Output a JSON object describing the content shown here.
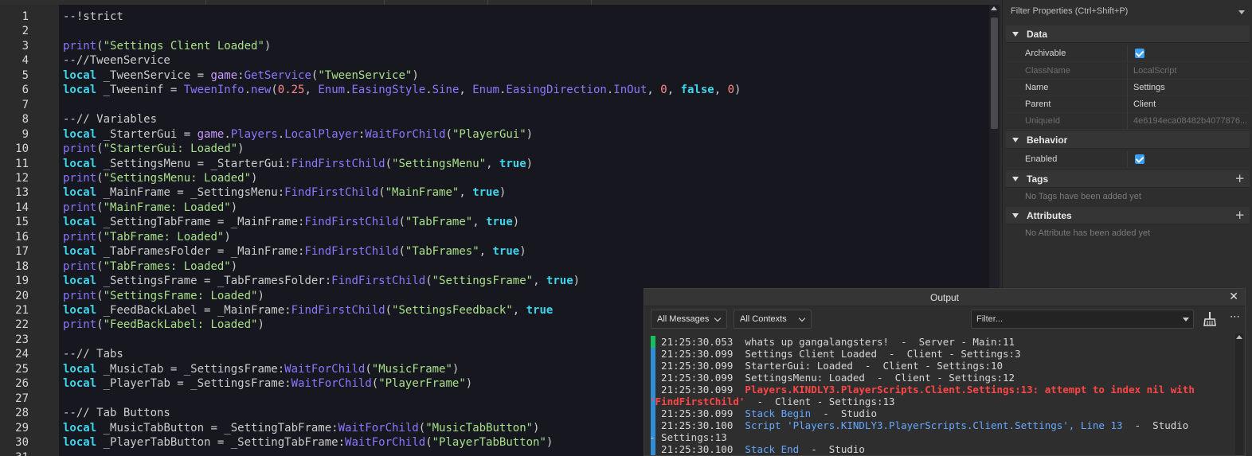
{
  "editor": {
    "lines": [
      {
        "n": "1",
        "tokens": [
          [
            "--!strict",
            "cm"
          ]
        ]
      },
      {
        "n": "2",
        "tokens": []
      },
      {
        "n": "3",
        "tokens": [
          [
            "print",
            "fn"
          ],
          [
            "(",
            "tx"
          ],
          [
            "\"Settings Client Loaded\"",
            "str"
          ],
          [
            ")",
            "tx"
          ]
        ]
      },
      {
        "n": "4",
        "tokens": [
          [
            "--//TweenService",
            "cm"
          ]
        ]
      },
      {
        "n": "5",
        "tokens": [
          [
            "local",
            "kw"
          ],
          [
            " _TweenService = ",
            "tx"
          ],
          [
            "game",
            "gm"
          ],
          [
            ":",
            "tx"
          ],
          [
            "GetService",
            "fn"
          ],
          [
            "(",
            "tx"
          ],
          [
            "\"TweenService\"",
            "str"
          ],
          [
            ")",
            "tx"
          ]
        ]
      },
      {
        "n": "6",
        "tokens": [
          [
            "local",
            "kw"
          ],
          [
            " _Tweeninf = ",
            "tx"
          ],
          [
            "TweenInfo",
            "fn"
          ],
          [
            ".",
            "tx"
          ],
          [
            "new",
            "fn"
          ],
          [
            "(",
            "tx"
          ],
          [
            "0.25",
            "num"
          ],
          [
            ", ",
            "tx"
          ],
          [
            "Enum",
            "fn"
          ],
          [
            ".",
            "tx"
          ],
          [
            "EasingStyle",
            "fn"
          ],
          [
            ".",
            "tx"
          ],
          [
            "Sine",
            "fn"
          ],
          [
            ", ",
            "tx"
          ],
          [
            "Enum",
            "fn"
          ],
          [
            ".",
            "tx"
          ],
          [
            "EasingDirection",
            "fn"
          ],
          [
            ".",
            "tx"
          ],
          [
            "InOut",
            "fn"
          ],
          [
            ", ",
            "tx"
          ],
          [
            "0",
            "num"
          ],
          [
            ", ",
            "tx"
          ],
          [
            "false",
            "bool"
          ],
          [
            ", ",
            "tx"
          ],
          [
            "0",
            "num"
          ],
          [
            ")",
            "tx"
          ]
        ]
      },
      {
        "n": "7",
        "tokens": []
      },
      {
        "n": "8",
        "tokens": [
          [
            "--// Variables",
            "cm"
          ]
        ]
      },
      {
        "n": "9",
        "tokens": [
          [
            "local",
            "kw"
          ],
          [
            " _StarterGui = ",
            "tx"
          ],
          [
            "game",
            "gm"
          ],
          [
            ".",
            "tx"
          ],
          [
            "Players",
            "fn"
          ],
          [
            ".",
            "tx"
          ],
          [
            "LocalPlayer",
            "fn"
          ],
          [
            ":",
            "tx"
          ],
          [
            "WaitForChild",
            "fn"
          ],
          [
            "(",
            "tx"
          ],
          [
            "\"PlayerGui\"",
            "str"
          ],
          [
            ")",
            "tx"
          ]
        ]
      },
      {
        "n": "10",
        "tokens": [
          [
            "print",
            "fn"
          ],
          [
            "(",
            "tx"
          ],
          [
            "\"StarterGui: Loaded\"",
            "str"
          ],
          [
            ")",
            "tx"
          ]
        ]
      },
      {
        "n": "11",
        "tokens": [
          [
            "local",
            "kw"
          ],
          [
            " _SettingsMenu = _StarterGui:",
            "tx"
          ],
          [
            "FindFirstChild",
            "fn"
          ],
          [
            "(",
            "tx"
          ],
          [
            "\"SettingsMenu\"",
            "str"
          ],
          [
            ", ",
            "tx"
          ],
          [
            "true",
            "bool"
          ],
          [
            ")",
            "tx"
          ]
        ]
      },
      {
        "n": "12",
        "tokens": [
          [
            "print",
            "fn"
          ],
          [
            "(",
            "tx"
          ],
          [
            "\"SettingsMenu: Loaded\"",
            "str"
          ],
          [
            ")",
            "tx"
          ]
        ]
      },
      {
        "n": "13",
        "tokens": [
          [
            "local",
            "kw"
          ],
          [
            " _MainFrame = _SettingsMenu:",
            "tx"
          ],
          [
            "FindFirstChild",
            "fn"
          ],
          [
            "(",
            "tx"
          ],
          [
            "\"MainFrame\"",
            "str"
          ],
          [
            ", ",
            "tx"
          ],
          [
            "true",
            "bool"
          ],
          [
            ")",
            "tx"
          ]
        ]
      },
      {
        "n": "14",
        "tokens": [
          [
            "print",
            "fn"
          ],
          [
            "(",
            "tx"
          ],
          [
            "\"MainFrame: Loaded\"",
            "str"
          ],
          [
            ")",
            "tx"
          ]
        ]
      },
      {
        "n": "15",
        "tokens": [
          [
            "local",
            "kw"
          ],
          [
            " _SettingTabFrame = _MainFrame:",
            "tx"
          ],
          [
            "FindFirstChild",
            "fn"
          ],
          [
            "(",
            "tx"
          ],
          [
            "\"TabFrame\"",
            "str"
          ],
          [
            ", ",
            "tx"
          ],
          [
            "true",
            "bool"
          ],
          [
            ")",
            "tx"
          ]
        ]
      },
      {
        "n": "16",
        "tokens": [
          [
            "print",
            "fn"
          ],
          [
            "(",
            "tx"
          ],
          [
            "\"TabFrame: Loaded\"",
            "str"
          ],
          [
            ")",
            "tx"
          ]
        ]
      },
      {
        "n": "17",
        "tokens": [
          [
            "local",
            "kw"
          ],
          [
            " _TabFramesFolder = _MainFrame:",
            "tx"
          ],
          [
            "FindFirstChild",
            "fn"
          ],
          [
            "(",
            "tx"
          ],
          [
            "\"TabFrames\"",
            "str"
          ],
          [
            ", ",
            "tx"
          ],
          [
            "true",
            "bool"
          ],
          [
            ")",
            "tx"
          ]
        ]
      },
      {
        "n": "18",
        "tokens": [
          [
            "print",
            "fn"
          ],
          [
            "(",
            "tx"
          ],
          [
            "\"TabFrames: Loaded\"",
            "str"
          ],
          [
            ")",
            "tx"
          ]
        ]
      },
      {
        "n": "19",
        "tokens": [
          [
            "local",
            "kw"
          ],
          [
            " _SettingsFrame = _TabFramesFolder:",
            "tx"
          ],
          [
            "FindFirstChild",
            "fn"
          ],
          [
            "(",
            "tx"
          ],
          [
            "\"SettingsFrame\"",
            "str"
          ],
          [
            ", ",
            "tx"
          ],
          [
            "true",
            "bool"
          ],
          [
            ")",
            "tx"
          ]
        ]
      },
      {
        "n": "20",
        "tokens": [
          [
            "print",
            "fn"
          ],
          [
            "(",
            "tx"
          ],
          [
            "\"SettingsFrame: Loaded\"",
            "str"
          ],
          [
            ")",
            "tx"
          ]
        ]
      },
      {
        "n": "21",
        "tokens": [
          [
            "local",
            "kw"
          ],
          [
            " _FeedBackLabel = _MainFrame:",
            "tx"
          ],
          [
            "FindFirstChild",
            "fn"
          ],
          [
            "(",
            "tx"
          ],
          [
            "\"SettingsFeedback\"",
            "str"
          ],
          [
            ", ",
            "tx"
          ],
          [
            "true",
            "bool"
          ]
        ]
      },
      {
        "n": "22",
        "tokens": [
          [
            "print",
            "fn"
          ],
          [
            "(",
            "tx"
          ],
          [
            "\"FeedBackLabel: Loaded\"",
            "str"
          ],
          [
            ")",
            "tx"
          ]
        ]
      },
      {
        "n": "23",
        "tokens": []
      },
      {
        "n": "24",
        "tokens": [
          [
            "--// Tabs",
            "cm"
          ]
        ]
      },
      {
        "n": "25",
        "tokens": [
          [
            "local",
            "kw"
          ],
          [
            " _MusicTab = _SettingsFrame:",
            "tx"
          ],
          [
            "WaitForChild",
            "fn"
          ],
          [
            "(",
            "tx"
          ],
          [
            "\"MusicFrame\"",
            "str"
          ],
          [
            ")",
            "tx"
          ]
        ]
      },
      {
        "n": "26",
        "tokens": [
          [
            "local",
            "kw"
          ],
          [
            " _PlayerTab = _SettingsFrame:",
            "tx"
          ],
          [
            "WaitForChild",
            "fn"
          ],
          [
            "(",
            "tx"
          ],
          [
            "\"PlayerFrame\"",
            "str"
          ],
          [
            ")",
            "tx"
          ]
        ]
      },
      {
        "n": "27",
        "tokens": []
      },
      {
        "n": "28",
        "tokens": [
          [
            "--// Tab Buttons",
            "cm"
          ]
        ]
      },
      {
        "n": "29",
        "tokens": [
          [
            "local",
            "kw"
          ],
          [
            " _MusicTabButton = _SettingTabFrame:",
            "tx"
          ],
          [
            "WaitForChild",
            "fn"
          ],
          [
            "(",
            "tx"
          ],
          [
            "\"MusicTabButton\"",
            "str"
          ],
          [
            ")",
            "tx"
          ]
        ]
      },
      {
        "n": "30",
        "tokens": [
          [
            "local",
            "kw"
          ],
          [
            " _PlayerTabButton = _SettingTabFrame:",
            "tx"
          ],
          [
            "WaitForChild",
            "fn"
          ],
          [
            "(",
            "tx"
          ],
          [
            "\"PlayerTabButton\"",
            "str"
          ],
          [
            ")",
            "tx"
          ]
        ]
      },
      {
        "n": "31",
        "tokens": []
      }
    ]
  },
  "properties": {
    "filter_placeholder": "Filter Properties (Ctrl+Shift+P)",
    "data_section": "Data",
    "archivable_key": "Archivable",
    "classname_key": "ClassName",
    "classname_val": "LocalScript",
    "name_key": "Name",
    "name_val": "Settings",
    "parent_key": "Parent",
    "parent_val": "Client",
    "uniqueid_key": "UniqueId",
    "uniqueid_val": "4e6194eca08482b4077876...",
    "behavior_section": "Behavior",
    "enabled_key": "Enabled",
    "tags_section": "Tags",
    "tags_empty": "No Tags have been added yet",
    "attributes_section": "Attributes",
    "attributes_empty": "No Attribute has been added yet",
    "plus": "+"
  },
  "output": {
    "title": "Output",
    "close": "✕",
    "messages_filter": "All Messages",
    "contexts_filter": "All Contexts",
    "filter_placeholder": "Filter...",
    "more": "⋯",
    "lines": [
      {
        "segments": [
          [
            "  21:25:30.053  ",
            "norm"
          ],
          [
            "whats up gangalangsters!  -  Server - Main:11",
            "norm"
          ]
        ]
      },
      {
        "segments": [
          [
            "  21:25:30.099  ",
            "norm"
          ],
          [
            "Settings Client Loaded  -  Client - Settings:3",
            "norm"
          ]
        ]
      },
      {
        "segments": [
          [
            "  21:25:30.099  ",
            "norm"
          ],
          [
            "StarterGui: Loaded  -  Client - Settings:10",
            "norm"
          ]
        ]
      },
      {
        "segments": [
          [
            "  21:25:30.099  ",
            "norm"
          ],
          [
            "SettingsMenu: Loaded  -  Client - Settings:12",
            "norm"
          ]
        ]
      },
      {
        "segments": [
          [
            "  21:25:30.099  ",
            "norm"
          ],
          [
            "Players.KINDLY3.PlayerScripts.Client.Settings:13: attempt to index nil with",
            "err"
          ]
        ]
      },
      {
        "segments": [
          [
            "'FindFirstChild'",
            "err"
          ],
          [
            "  -  Client - Settings:13",
            "norm"
          ]
        ]
      },
      {
        "segments": [
          [
            "  21:25:30.099  ",
            "norm"
          ],
          [
            "Stack Begin",
            "info"
          ],
          [
            "  -  Studio",
            "norm"
          ]
        ]
      },
      {
        "segments": [
          [
            "  21:25:30.100  ",
            "norm"
          ],
          [
            "Script 'Players.KINDLY3.PlayerScripts.Client.Settings', Line 13",
            "info"
          ],
          [
            "  -  Studio",
            "norm"
          ]
        ]
      },
      {
        "segments": [
          [
            "- Settings:13",
            "norm"
          ]
        ]
      },
      {
        "segments": [
          [
            "  21:25:30.100  ",
            "norm"
          ],
          [
            "Stack End",
            "info"
          ],
          [
            "  -  Studio",
            "norm"
          ]
        ]
      }
    ]
  },
  "colors": {
    "marker_green": "#16c060",
    "marker_blue": "#2e8fd8"
  }
}
